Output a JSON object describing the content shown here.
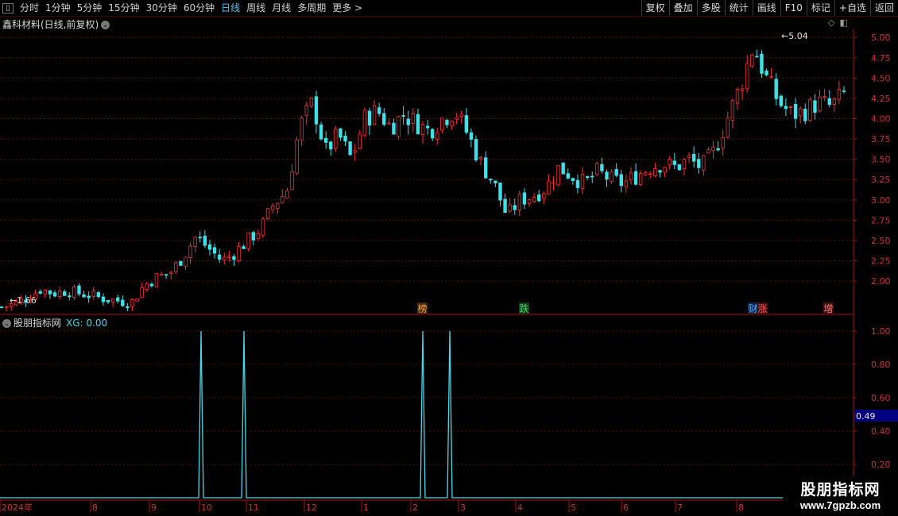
{
  "toolbar": {
    "periods": [
      {
        "label": "分时",
        "active": false
      },
      {
        "label": "1分钟",
        "active": false
      },
      {
        "label": "5分钟",
        "active": false
      },
      {
        "label": "15分钟",
        "active": false
      },
      {
        "label": "30分钟",
        "active": false
      },
      {
        "label": "60分钟",
        "active": false
      },
      {
        "label": "日线",
        "active": true
      },
      {
        "label": "周线",
        "active": false
      },
      {
        "label": "月线",
        "active": false
      },
      {
        "label": "多周期",
        "active": false
      },
      {
        "label": "更多 >",
        "active": false
      }
    ],
    "right_buttons": [
      "复权",
      "叠加",
      "多股",
      "统计",
      "画线",
      "F10",
      "标记",
      "+自选",
      "返回"
    ]
  },
  "main_chart": {
    "title": "鑫科材料(日线,前复权)",
    "high_label": "5.04",
    "low_label": "1.66",
    "y_ticks": [
      "5.00",
      "4.75",
      "4.50",
      "4.25",
      "4.00",
      "3.75",
      "3.50",
      "3.25",
      "3.00",
      "2.75",
      "2.50",
      "2.25",
      "2.00"
    ],
    "markers": [
      {
        "label": "榜",
        "color": "#ff9933",
        "bg": "#3a2a10"
      },
      {
        "label": "跌",
        "color": "#33dd66",
        "bg": "#103a18"
      },
      {
        "label": "财",
        "color": "#55aaff",
        "bg": "#102040"
      },
      {
        "label": "涨",
        "color": "#ff5555",
        "bg": "#3a1010"
      },
      {
        "label": "增",
        "color": "#ff7777",
        "bg": "#3a1010"
      }
    ]
  },
  "indicator": {
    "name": "股朋指标网",
    "xg_label": "XG: 0.00",
    "y_ticks": [
      "1.00",
      "0.80",
      "0.60",
      "0.40",
      "0.20"
    ],
    "current_value": "0.49"
  },
  "x_axis": {
    "labels": [
      "2024年",
      "8",
      "9",
      "10",
      "11",
      "12",
      "1",
      "2",
      "3",
      "4",
      "5",
      "6",
      "7",
      "8"
    ]
  },
  "watermark": {
    "line1": "股朋指标网",
    "line2": "www.7gpzb.com"
  },
  "chart_data": [
    {
      "type": "candlestick",
      "title": "鑫科材料(日线,前复权)",
      "ylim": [
        1.6,
        5.1
      ],
      "high": 5.04,
      "low": 1.66,
      "x_labels": [
        "2024年",
        "8",
        "9",
        "10",
        "11",
        "12",
        "1",
        "2",
        "3",
        "4",
        "5",
        "6",
        "7",
        "8"
      ],
      "close_path": [
        1.68,
        1.72,
        1.8,
        1.9,
        1.85,
        1.88,
        1.85,
        1.82,
        1.78,
        1.76,
        1.73,
        1.95,
        2.05,
        2.1,
        2.3,
        2.55,
        2.4,
        2.25,
        2.35,
        2.5,
        2.65,
        2.95,
        3.1,
        3.9,
        4.2,
        3.6,
        3.8,
        3.5,
        4.0,
        4.1,
        3.9,
        4.05,
        3.95,
        3.85,
        4.0,
        4.1,
        3.8,
        3.45,
        3.2,
        2.8,
        3.0,
        3.05,
        3.15,
        3.4,
        3.3,
        3.2,
        3.35,
        3.25,
        3.2,
        3.3,
        3.4,
        3.45,
        3.4,
        3.5,
        3.4,
        3.6,
        4.0,
        4.4,
        4.9,
        4.5,
        4.2,
        4.05,
        4.1,
        4.2,
        4.15,
        4.3
      ]
    },
    {
      "type": "line",
      "series": [
        {
          "name": "XG",
          "values": [
            0,
            0,
            1,
            0,
            1,
            0,
            1,
            0,
            1,
            0,
            0
          ]
        }
      ],
      "signal_positions": [
        "10",
        "11",
        "2",
        "3"
      ],
      "ylim": [
        0,
        1.0
      ],
      "current_value": 0.49
    }
  ]
}
